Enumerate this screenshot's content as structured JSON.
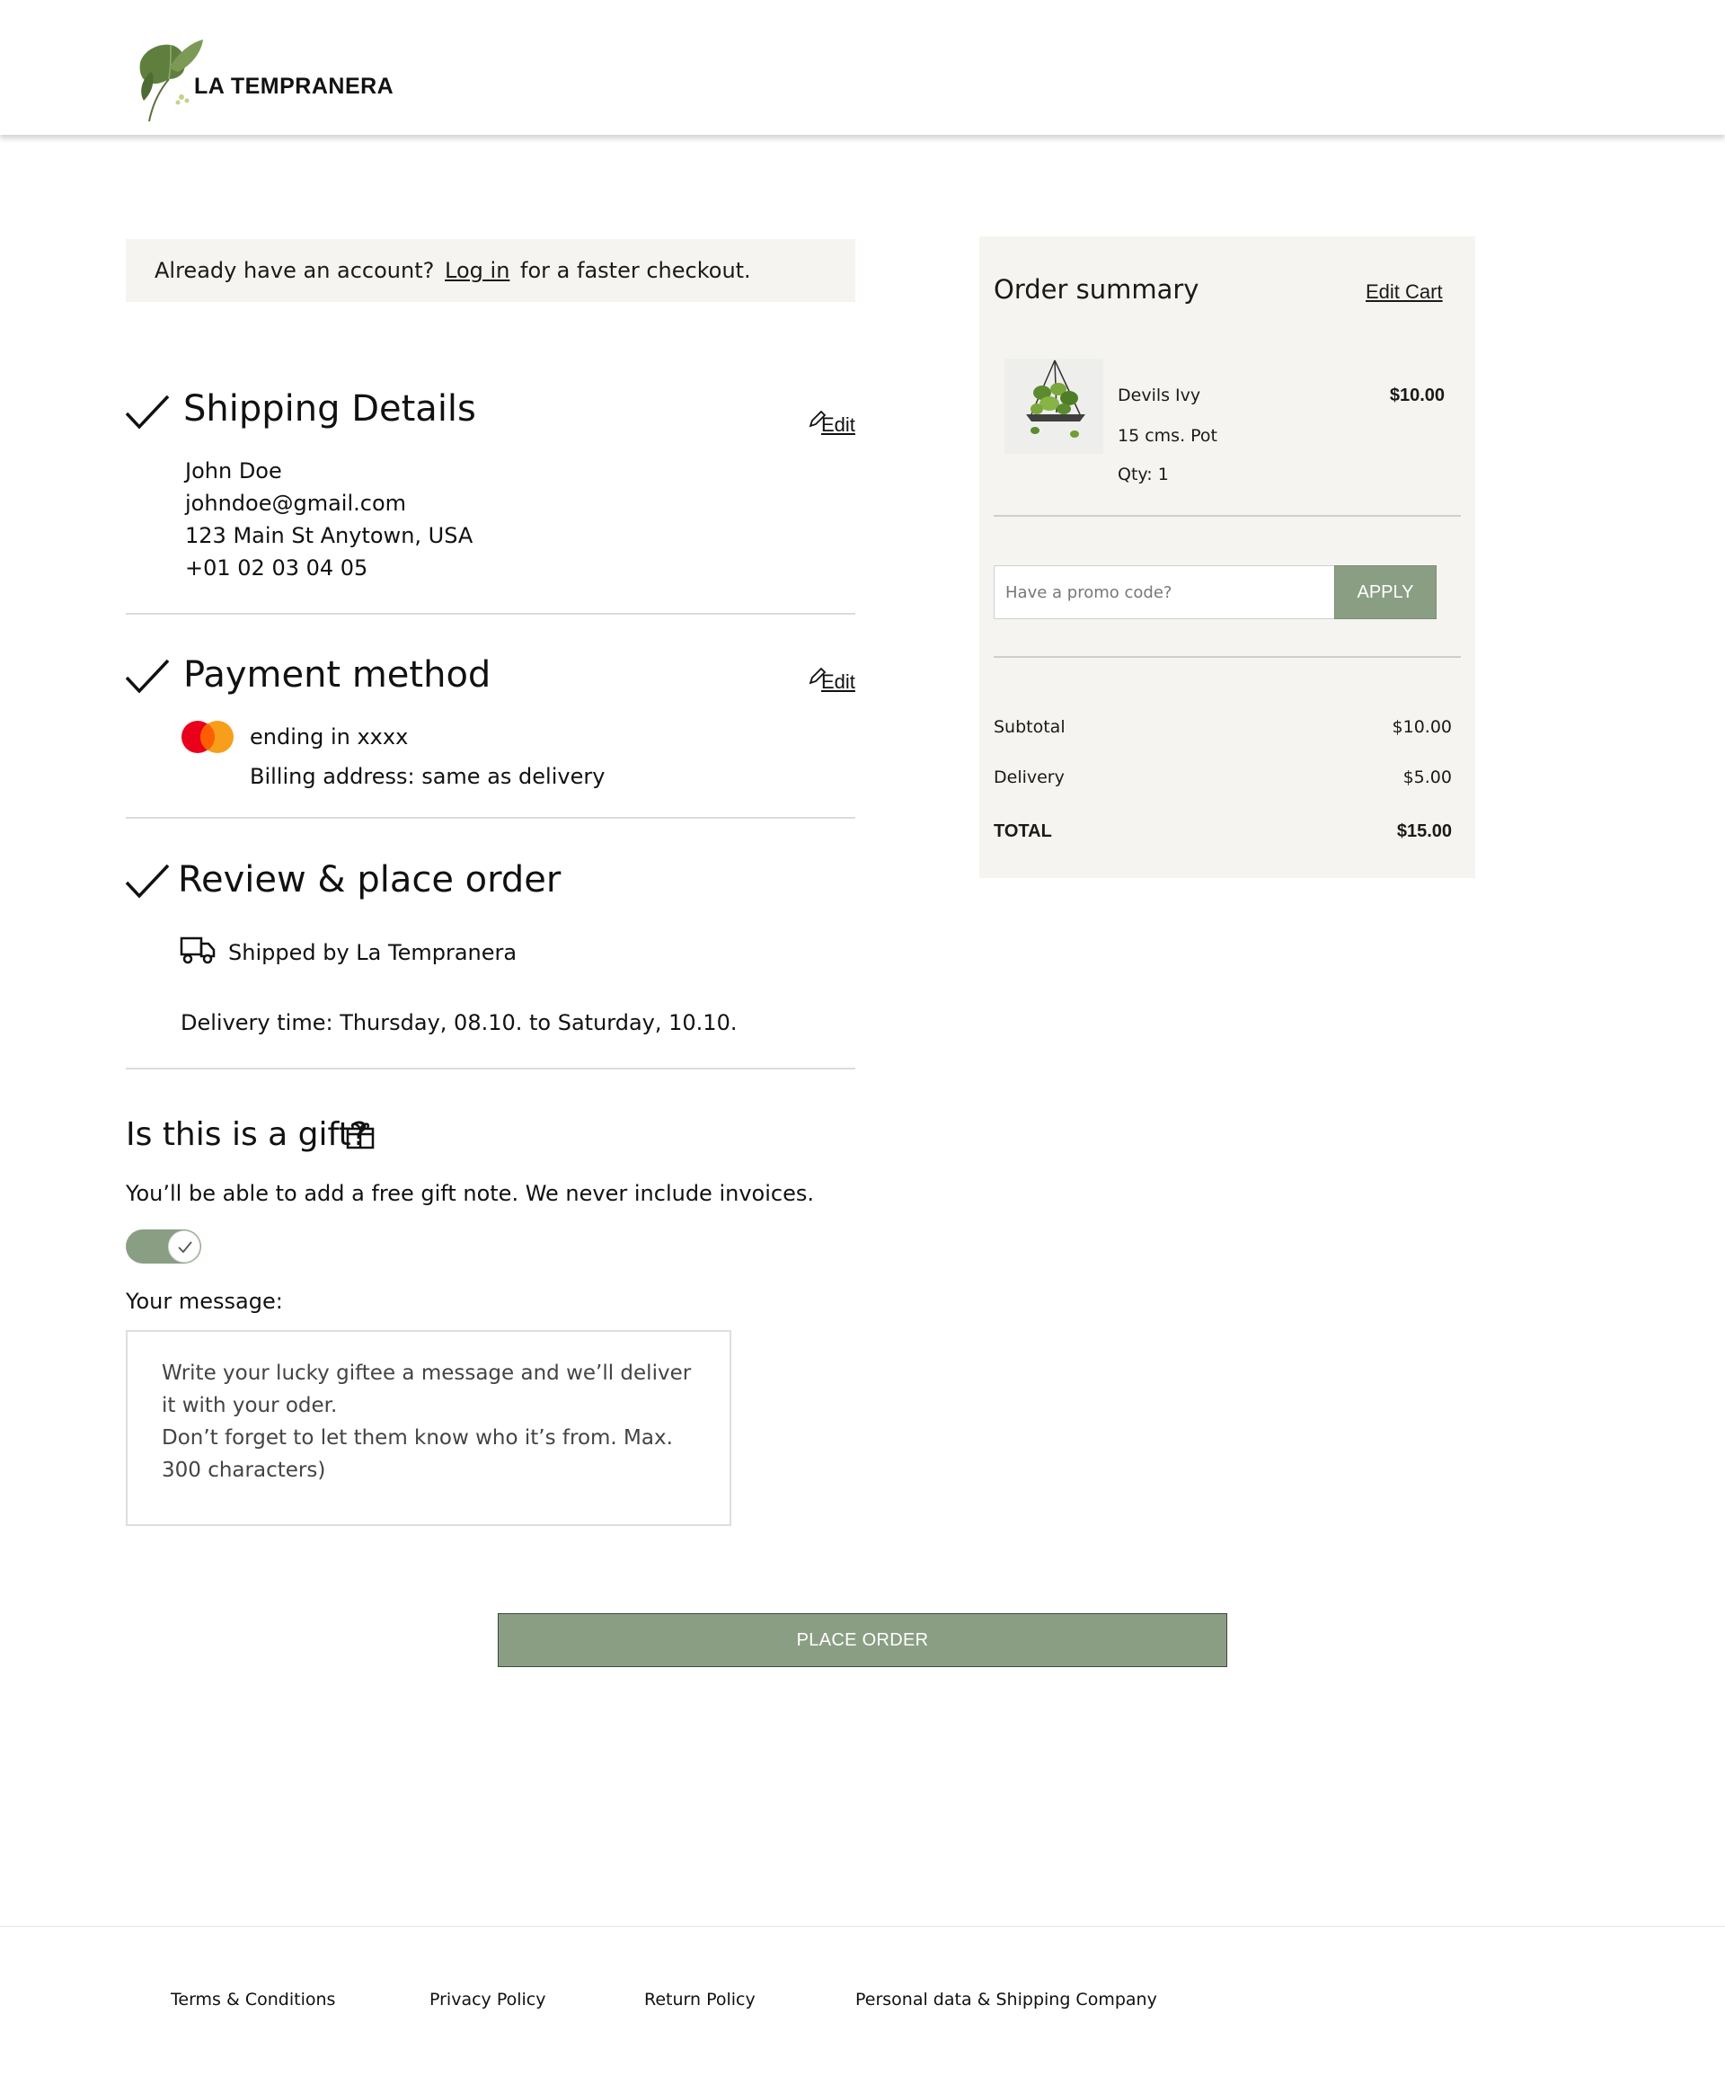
{
  "brand": {
    "name": "LA TEMPRANERA"
  },
  "login_banner": {
    "prefix": "Already have an account?",
    "link": "Log in",
    "suffix": "for a faster checkout."
  },
  "shipping": {
    "title": "Shipping Details",
    "edit_label": "Edit",
    "name": "John Doe",
    "email": "johndoe@gmail.com",
    "address": "123 Main St Anytown, USA",
    "phone": "+01 02 03 04 05"
  },
  "payment": {
    "title": "Payment method",
    "edit_label": "Edit",
    "card_text": "ending in xxxx",
    "billing": "Billing address: same as delivery",
    "card_colors": [
      "#eb001b",
      "#f79e1b"
    ]
  },
  "review": {
    "title": "Review & place order",
    "shipped_by": "Shipped by La Tempranera",
    "delivery_time": "Delivery time: Thursday, 08.10. to Saturday, 10.10."
  },
  "gift": {
    "title": "Is this is a gift?",
    "description": "You’ll be able to add a free gift note. We never include invoices.",
    "toggle_on": true,
    "message_label": "Your message:",
    "message_placeholder": "Write your lucky giftee a message and we’ll deliver it with your oder.\nDon’t forget to let them know who it’s from. Max. 300 characters)"
  },
  "place_order_label": "PLACE ORDER",
  "summary": {
    "title": "Order summary",
    "edit_cart": "Edit Cart",
    "item": {
      "name": "Devils Ivy",
      "variant": "15 cms. Pot",
      "qty": "Qty: 1",
      "price": "$10.00"
    },
    "promo_placeholder": "Have a promo code?",
    "apply_label": "APPLY",
    "subtotal_label": "Subtotal",
    "subtotal_value": "$10.00",
    "delivery_label": "Delivery",
    "delivery_value": "$5.00",
    "total_label": "TOTAL",
    "total_value": "$15.00"
  },
  "colors": {
    "accent": "#8a9e84",
    "panel": "#f5f4f0"
  },
  "footer": {
    "links": [
      "Terms & Conditions",
      "Privacy Policy",
      "Return Policy",
      "Personal data & Shipping Company"
    ]
  }
}
